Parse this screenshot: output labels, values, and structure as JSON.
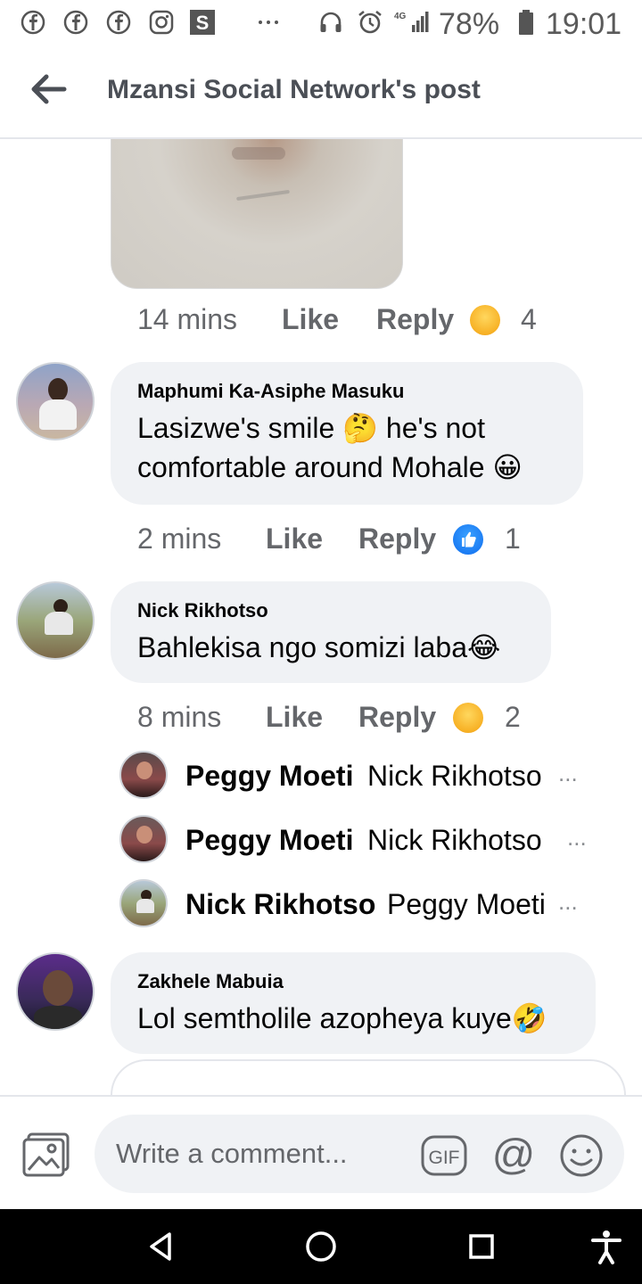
{
  "status_bar": {
    "left_icons": [
      "facebook-icon",
      "facebook-icon",
      "facebook-icon",
      "instagram-icon",
      "s-app-icon",
      "more-dots-icon"
    ],
    "right_icons": [
      "headphones-icon",
      "alarm-icon",
      "signal-4g-icon",
      "battery-icon"
    ],
    "battery": "78%",
    "time": "19:01",
    "network": "4G"
  },
  "header": {
    "title": "Mzansi Social Network's post",
    "back_icon": "arrow-left-icon"
  },
  "first_meta": {
    "time": "14 mins",
    "like": "Like",
    "reply": "Reply",
    "reaction": "haha",
    "count": "4"
  },
  "comments": [
    {
      "name": "Maphumi Ka-Asiphe Masuku",
      "text_line1": "Lasizwe's smile 🤔 he's not",
      "text_line2": "comfortable around Mohale 😀",
      "time": "2 mins",
      "like": "Like",
      "reply": "Reply",
      "reaction": "like",
      "count": "1"
    },
    {
      "name": "Nick Rikhotso",
      "text_line1": "Bahlekisa ngo somizi laba😂",
      "time": "8 mins",
      "like": "Like",
      "reply": "Reply",
      "reaction": "haha",
      "count": "2",
      "replies": [
        {
          "name": "Peggy Moeti",
          "text": "Nick Rikhotso",
          "more": "..."
        },
        {
          "name": "Peggy Moeti",
          "text": "Nick Rikhotso",
          "more": "..."
        },
        {
          "name": "Nick Rikhotso",
          "text": "Peggy Moeti",
          "more": "..."
        }
      ]
    },
    {
      "name": "Zakhele Mabuia",
      "text_line1": "Lol semtholile azopheya kuye🤣"
    }
  ],
  "composer": {
    "placeholder": "Write a comment...",
    "gif_label": "GIF",
    "at_label": "@",
    "icons": [
      "photo-icon",
      "gif-icon",
      "mention-icon",
      "emoji-icon"
    ]
  },
  "nav": {
    "icons": [
      "back-triangle-icon",
      "home-circle-icon",
      "recents-square-icon",
      "accessibility-icon"
    ]
  },
  "colors": {
    "accent": "#1877f2",
    "bubble": "#f0f2f5",
    "meta_text": "#65676b",
    "haha": "#f7b125"
  }
}
